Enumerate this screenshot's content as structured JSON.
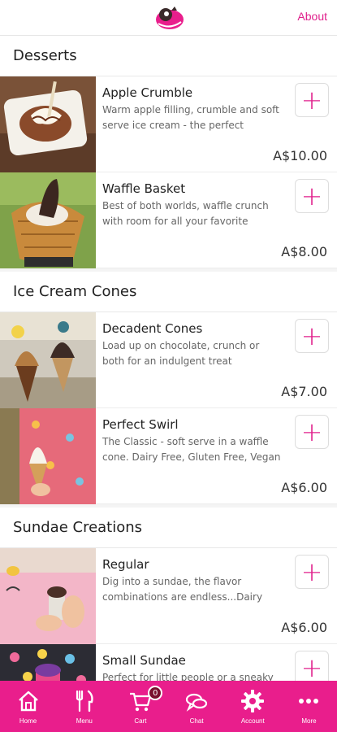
{
  "header": {
    "about_label": "About"
  },
  "sections": [
    {
      "title": "Desserts",
      "items": [
        {
          "name": "Apple Crumble",
          "desc": "Warm apple filling, crumble and soft serve ice cream - the perfect winter...",
          "price": "A$10.00"
        },
        {
          "name": "Waffle Basket",
          "desc": "Best of both worlds, waffle crunch with room for all your favorite extras...",
          "price": "A$8.00"
        }
      ]
    },
    {
      "title": "Ice Cream Cones",
      "items": [
        {
          "name": "Decadent Cones",
          "desc": "Load up on chocolate, crunch or both for an indulgent treat",
          "price": "A$7.00"
        },
        {
          "name": "Perfect Swirl",
          "desc": "The Classic - soft serve in a waffle cone. Dairy Free, Gluten Free, Vegan",
          "price": "A$6.00"
        }
      ]
    },
    {
      "title": "Sundae Creations",
      "items": [
        {
          "name": "Regular",
          "desc": "Dig into a sundae, the flavor combinations are endless...Dairy free,...",
          "price": "A$6.00"
        },
        {
          "name": "Small Sundae",
          "desc": "Perfect for little people or a sneaky",
          "price": ""
        }
      ]
    }
  ],
  "add_symbol": "+",
  "tabbar": {
    "accent": "#e91e8c",
    "cart_count": "0",
    "tabs": [
      {
        "label": "Home",
        "icon": "home-icon"
      },
      {
        "label": "Menu",
        "icon": "fork-knife-icon"
      },
      {
        "label": "Cart",
        "icon": "cart-icon"
      },
      {
        "label": "Chat",
        "icon": "chat-icon"
      },
      {
        "label": "Account",
        "icon": "gear-icon"
      },
      {
        "label": "More",
        "icon": "more-icon"
      }
    ]
  }
}
